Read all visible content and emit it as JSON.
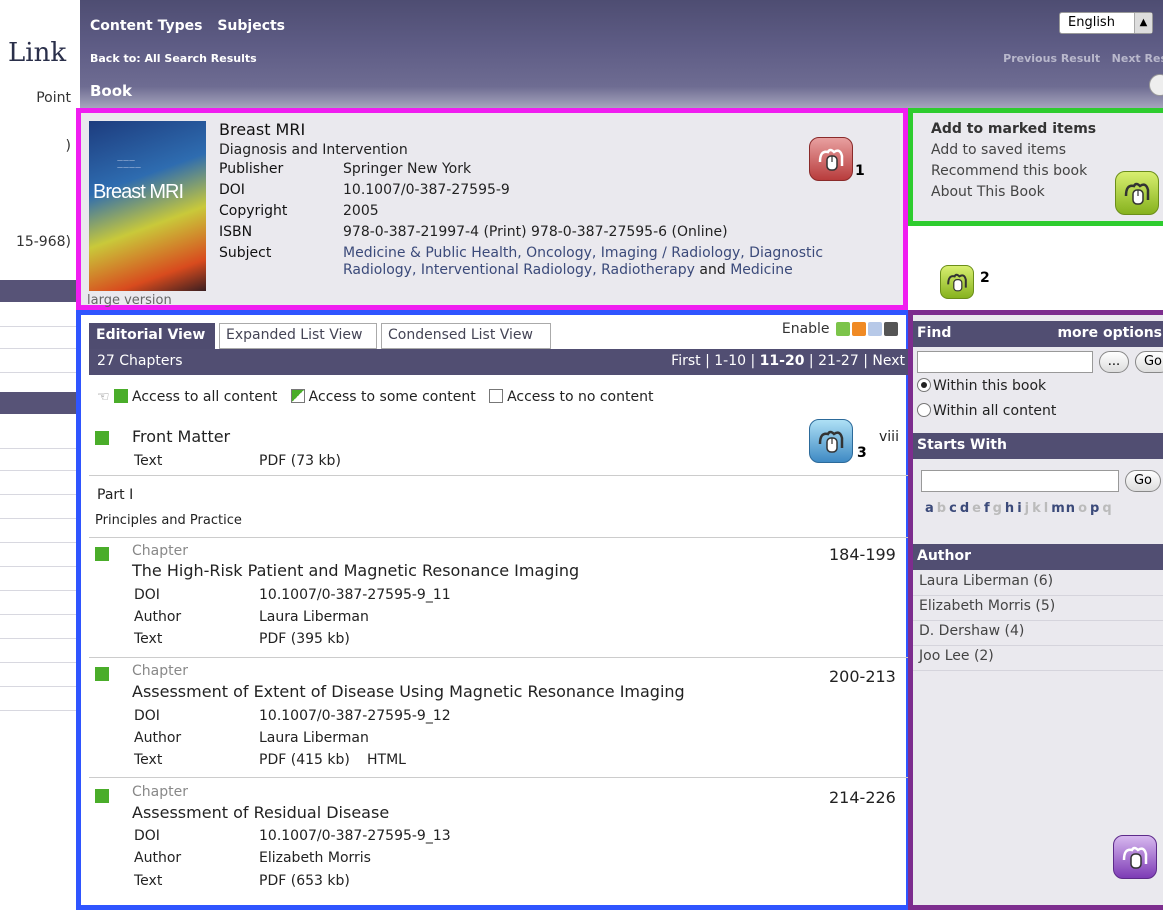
{
  "left": {
    "logo": "Link",
    "point": "Point",
    "paren": ")",
    "range": "15-968)"
  },
  "header": {
    "nav": [
      "Content Types",
      "Subjects"
    ],
    "back": "Back to: All Search Results",
    "prev": "Previous Result",
    "next": "Next Res",
    "section": "Book",
    "language": "English"
  },
  "book": {
    "cover_title": "Breast MRI",
    "large_version": "large version",
    "title": "Breast MRI",
    "subtitle": "Diagnosis and Intervention",
    "fields": [
      {
        "k": "Publisher",
        "v": "Springer New York"
      },
      {
        "k": "DOI",
        "v": "10.1007/0-387-27595-9"
      },
      {
        "k": "Copyright",
        "v": "2005"
      },
      {
        "k": "ISBN",
        "v": "978-0-387-21997-4 (Print) 978-0-387-27595-6 (Online)"
      }
    ],
    "subject_k": "Subject",
    "subject_v": "Medicine & Public Health, Oncology, Imaging / Radiology, Diagnostic Radiology, Interventional Radiology, Radiotherapy",
    "subject_and": "and",
    "subject_last": "Medicine"
  },
  "markers": {
    "m1": "1",
    "m2": "2",
    "m3": "3"
  },
  "actions": [
    "Add to marked items",
    "Add to saved items",
    "Recommend this book",
    "About This Book"
  ],
  "list": {
    "tabs": [
      "Editorial View",
      "Expanded List View",
      "Condensed List View"
    ],
    "enable": "Enable",
    "count": "27 Chapters",
    "pages": {
      "first": "First",
      "p1": "1-10",
      "p2": "11-20",
      "p3": "21-27",
      "next": "Next",
      "sep": "|"
    },
    "legend": [
      "Access to all content",
      "Access to some content",
      "Access to no content"
    ],
    "front": {
      "title": "Front Matter",
      "pages": "viii",
      "k": "Text",
      "v": "PDF (73 kb)"
    },
    "part": {
      "num": "Part I",
      "title": "Principles and Practice"
    },
    "chapters": [
      {
        "type": "Chapter",
        "title": "The High-Risk Patient and Magnetic Resonance Imaging",
        "pages": "184-199",
        "doi": "10.1007/0-387-27595-9_11",
        "author": "Laura Liberman",
        "text": "PDF (395 kb)",
        "html": ""
      },
      {
        "type": "Chapter",
        "title": "Assessment of Extent of Disease Using Magnetic Resonance Imaging",
        "pages": "200-213",
        "doi": "10.1007/0-387-27595-9_12",
        "author": "Laura Liberman",
        "text": "PDF (415 kb)",
        "html": "HTML"
      },
      {
        "type": "Chapter",
        "title": "Assessment of Residual Disease",
        "pages": "214-226",
        "doi": "10.1007/0-387-27595-9_13",
        "author": "Elizabeth Morris",
        "text": "PDF (653 kb)",
        "html": ""
      }
    ],
    "labels": {
      "doi": "DOI",
      "author": "Author",
      "text": "Text"
    }
  },
  "sidebar": {
    "find": "Find",
    "more": "more options",
    "dots": "...",
    "go": "Go",
    "within_book": "Within this book",
    "within_all": "Within all content",
    "starts": "Starts With",
    "letters": [
      "a",
      "b",
      "c",
      "d",
      "e",
      "f",
      "g",
      "h",
      "i",
      "j",
      "k",
      "l",
      "mn",
      "o",
      "p",
      "q"
    ],
    "author_head": "Author",
    "authors": [
      "Laura Liberman (6)",
      "Elizabeth Morris (5)",
      "D. Dershaw (4)",
      "Joo Lee (2)"
    ]
  }
}
